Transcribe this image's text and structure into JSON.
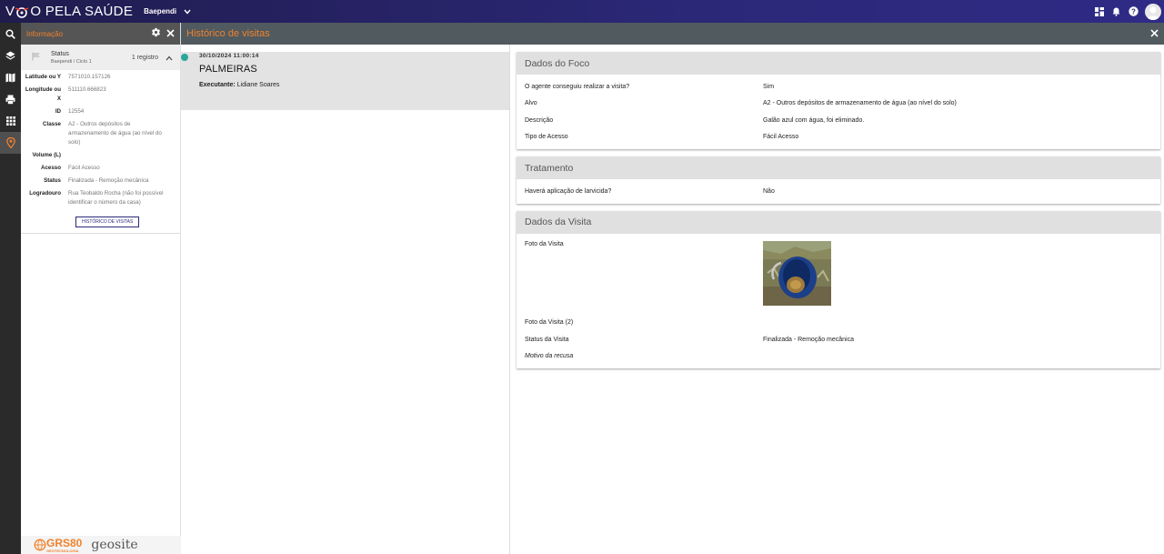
{
  "app": {
    "title_part1": "V",
    "title_part2": "O PELA SAÚDE",
    "city": "Baependi"
  },
  "colors": {
    "accent": "#f0822d",
    "topbar": "#2b2878",
    "status_dot": "#2aa79b"
  },
  "topbar_icons": [
    "dashboard-icon",
    "bell-icon",
    "help-icon",
    "avatar"
  ],
  "sidenav": [
    "search-icon",
    "layers-icon",
    "map-icon",
    "print-icon",
    "apps-icon",
    "location-pin-icon"
  ],
  "info_panel": {
    "title": "Informação",
    "status_label": "Status",
    "status_sub": "Baependi / Ciclo 1",
    "count": "1 registro",
    "attributes": [
      {
        "k": "Latitude ou Y",
        "v": "7571010.157126"
      },
      {
        "k": "Longitude ou X",
        "v": "511110.666823"
      },
      {
        "k": "ID",
        "v": "12554"
      },
      {
        "k": "Classe",
        "v": "A2 - Outros depósitos de armazenamento de água (ao nível do solo)"
      },
      {
        "k": "Volume (L)",
        "v": ""
      },
      {
        "k": "Acesso",
        "v": "Fácil Acesso"
      },
      {
        "k": "Status",
        "v": "Finalizada - Remoção mecânica"
      },
      {
        "k": "Logradouro",
        "v": "Rua Teobaldo Rocha (não foi possível identificar o número da casa)"
      }
    ],
    "history_button": "HISTÓRICO DE VISITAS",
    "footer": {
      "grs": "GRS80",
      "grs_sub": "GEOTECNOLOGIA",
      "geosite": "geosite"
    }
  },
  "main": {
    "title": "Histórico de visitas",
    "visit": {
      "date": "30/10/2024 11:00:14",
      "name": "PALMEIRAS",
      "exec_label": "Executante:",
      "exec_value": "Lidiane Soares"
    }
  },
  "cards": {
    "foco": {
      "title": "Dados do Foco",
      "rows": [
        {
          "k": "O agente conseguiu realizar a visita?",
          "v": "Sim"
        },
        {
          "k": "Alvo",
          "v": "A2 - Outros depósitos de armazenamento de água (ao nível do solo)"
        },
        {
          "k": "Descrição",
          "v": "Galão azul com água, foi eliminado."
        },
        {
          "k": "Tipo de Acesso",
          "v": "Fácil Acesso"
        }
      ]
    },
    "tratamento": {
      "title": "Tratamento",
      "rows": [
        {
          "k": "Haverá aplicação de larvicida?",
          "v": "Não"
        }
      ]
    },
    "visita": {
      "title": "Dados da Visita",
      "photo_label": "Foto da Visita",
      "photo2_label": "Foto da Visita (2)",
      "status_label": "Status da Visita",
      "status_value": "Finalizada - Remoção mecânica",
      "refusal_label": "Motivo da recusa"
    }
  }
}
